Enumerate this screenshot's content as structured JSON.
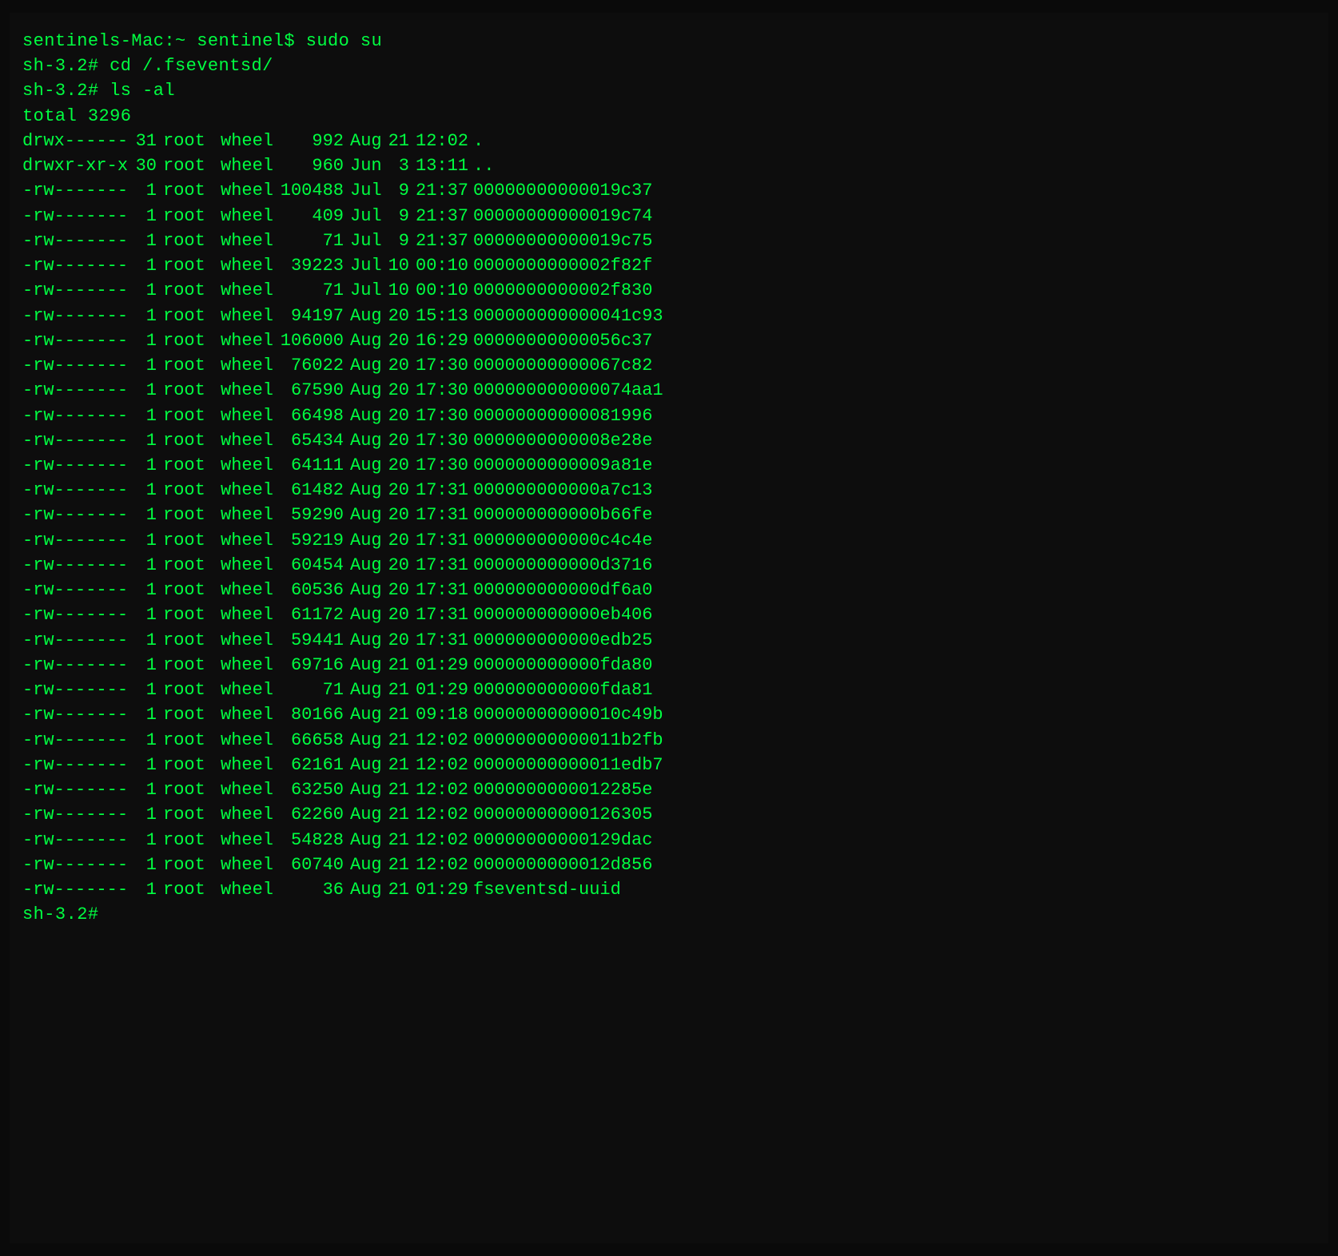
{
  "terminal": {
    "title": "sentinels-Mac:~ sentinel$",
    "prompt": "sh-3.2#",
    "lines": [
      {
        "type": "prompt-line",
        "text": "sentinels-Mac:~ sentinel$ sudo su"
      },
      {
        "type": "prompt-line",
        "text": "sh-3.2# cd /.fseventsd/"
      },
      {
        "type": "prompt-line",
        "text": "sh-3.2# ls -al"
      },
      {
        "type": "total",
        "text": "total 3296"
      },
      {
        "type": "file",
        "perms": "drwx------",
        "links": "31",
        "owner": "root",
        "group": "wheel",
        "size": "992",
        "month": "Aug",
        "day": "21",
        "time": "12:02",
        "name": "."
      },
      {
        "type": "file",
        "perms": "drwxr-xr-x",
        "links": "30",
        "owner": "root",
        "group": "wheel",
        "size": "960",
        "month": "Jun",
        "day": " 3",
        "time": "13:11",
        "name": ".."
      },
      {
        "type": "file",
        "perms": "-rw-------",
        "links": " 1",
        "owner": "root",
        "group": "wheel",
        "size": "100488",
        "month": "Jul",
        "day": " 9",
        "time": "21:37",
        "name": "00000000000019c37"
      },
      {
        "type": "file",
        "perms": "-rw-------",
        "links": " 1",
        "owner": "root",
        "group": "wheel",
        "size": "409",
        "month": "Jul",
        "day": " 9",
        "time": "21:37",
        "name": "00000000000019c74"
      },
      {
        "type": "file",
        "perms": "-rw-------",
        "links": " 1",
        "owner": "root",
        "group": "wheel",
        "size": "71",
        "month": "Jul",
        "day": " 9",
        "time": "21:37",
        "name": "00000000000019c75"
      },
      {
        "type": "file",
        "perms": "-rw-------",
        "links": " 1",
        "owner": "root",
        "group": "wheel",
        "size": "39223",
        "month": "Jul",
        "day": "10",
        "time": "00:10",
        "name": "0000000000002f82f"
      },
      {
        "type": "file",
        "perms": "-rw-------",
        "links": " 1",
        "owner": "root",
        "group": "wheel",
        "size": "71",
        "month": "Jul",
        "day": "10",
        "time": "00:10",
        "name": "0000000000002f830"
      },
      {
        "type": "file",
        "perms": "-rw-------",
        "links": " 1",
        "owner": "root",
        "group": "wheel",
        "size": "94197",
        "month": "Aug",
        "day": "20",
        "time": "15:13",
        "name": "000000000000041c93"
      },
      {
        "type": "file",
        "perms": "-rw-------",
        "links": " 1",
        "owner": "root",
        "group": "wheel",
        "size": "106000",
        "month": "Aug",
        "day": "20",
        "time": "16:29",
        "name": "00000000000056c37"
      },
      {
        "type": "file",
        "perms": "-rw-------",
        "links": " 1",
        "owner": "root",
        "group": "wheel",
        "size": "76022",
        "month": "Aug",
        "day": "20",
        "time": "17:30",
        "name": "00000000000067c82"
      },
      {
        "type": "file",
        "perms": "-rw-------",
        "links": " 1",
        "owner": "root",
        "group": "wheel",
        "size": "67590",
        "month": "Aug",
        "day": "20",
        "time": "17:30",
        "name": "000000000000074aa1"
      },
      {
        "type": "file",
        "perms": "-rw-------",
        "links": " 1",
        "owner": "root",
        "group": "wheel",
        "size": "66498",
        "month": "Aug",
        "day": "20",
        "time": "17:30",
        "name": "00000000000081996"
      },
      {
        "type": "file",
        "perms": "-rw-------",
        "links": " 1",
        "owner": "root",
        "group": "wheel",
        "size": "65434",
        "month": "Aug",
        "day": "20",
        "time": "17:30",
        "name": "0000000000008e28e"
      },
      {
        "type": "file",
        "perms": "-rw-------",
        "links": " 1",
        "owner": "root",
        "group": "wheel",
        "size": "64111",
        "month": "Aug",
        "day": "20",
        "time": "17:30",
        "name": "0000000000009a81e"
      },
      {
        "type": "file",
        "perms": "-rw-------",
        "links": " 1",
        "owner": "root",
        "group": "wheel",
        "size": "61482",
        "month": "Aug",
        "day": "20",
        "time": "17:31",
        "name": "000000000000a7c13"
      },
      {
        "type": "file",
        "perms": "-rw-------",
        "links": " 1",
        "owner": "root",
        "group": "wheel",
        "size": "59290",
        "month": "Aug",
        "day": "20",
        "time": "17:31",
        "name": "000000000000b66fe"
      },
      {
        "type": "file",
        "perms": "-rw-------",
        "links": " 1",
        "owner": "root",
        "group": "wheel",
        "size": "59219",
        "month": "Aug",
        "day": "20",
        "time": "17:31",
        "name": "000000000000c4c4e"
      },
      {
        "type": "file",
        "perms": "-rw-------",
        "links": " 1",
        "owner": "root",
        "group": "wheel",
        "size": "60454",
        "month": "Aug",
        "day": "20",
        "time": "17:31",
        "name": "000000000000d3716"
      },
      {
        "type": "file",
        "perms": "-rw-------",
        "links": " 1",
        "owner": "root",
        "group": "wheel",
        "size": "60536",
        "month": "Aug",
        "day": "20",
        "time": "17:31",
        "name": "000000000000df6a0"
      },
      {
        "type": "file",
        "perms": "-rw-------",
        "links": " 1",
        "owner": "root",
        "group": "wheel",
        "size": "61172",
        "month": "Aug",
        "day": "20",
        "time": "17:31",
        "name": "000000000000eb406"
      },
      {
        "type": "file",
        "perms": "-rw-------",
        "links": " 1",
        "owner": "root",
        "group": "wheel",
        "size": "59441",
        "month": "Aug",
        "day": "20",
        "time": "17:31",
        "name": "000000000000edb25"
      },
      {
        "type": "file",
        "perms": "-rw-------",
        "links": " 1",
        "owner": "root",
        "group": "wheel",
        "size": "69716",
        "month": "Aug",
        "day": "21",
        "time": "01:29",
        "name": "000000000000fda80"
      },
      {
        "type": "file",
        "perms": "-rw-------",
        "links": " 1",
        "owner": "root",
        "group": "wheel",
        "size": "71",
        "month": "Aug",
        "day": "21",
        "time": "01:29",
        "name": "000000000000fda81"
      },
      {
        "type": "file",
        "perms": "-rw-------",
        "links": " 1",
        "owner": "root",
        "group": "wheel",
        "size": "80166",
        "month": "Aug",
        "day": "21",
        "time": "09:18",
        "name": "00000000000010c49b"
      },
      {
        "type": "file",
        "perms": "-rw-------",
        "links": " 1",
        "owner": "root",
        "group": "wheel",
        "size": "66658",
        "month": "Aug",
        "day": "21",
        "time": "12:02",
        "name": "00000000000011b2fb"
      },
      {
        "type": "file",
        "perms": "-rw-------",
        "links": " 1",
        "owner": "root",
        "group": "wheel",
        "size": "62161",
        "month": "Aug",
        "day": "21",
        "time": "12:02",
        "name": "00000000000011edb7"
      },
      {
        "type": "file",
        "perms": "-rw-------",
        "links": " 1",
        "owner": "root",
        "group": "wheel",
        "size": "63250",
        "month": "Aug",
        "day": "21",
        "time": "12:02",
        "name": "0000000000012285e"
      },
      {
        "type": "file",
        "perms": "-rw-------",
        "links": " 1",
        "owner": "root",
        "group": "wheel",
        "size": "62260",
        "month": "Aug",
        "day": "21",
        "time": "12:02",
        "name": "00000000000126305"
      },
      {
        "type": "file",
        "perms": "-rw-------",
        "links": " 1",
        "owner": "root",
        "group": "wheel",
        "size": "54828",
        "month": "Aug",
        "day": "21",
        "time": "12:02",
        "name": "00000000000129dac"
      },
      {
        "type": "file",
        "perms": "-rw-------",
        "links": " 1",
        "owner": "root",
        "group": "wheel",
        "size": "60740",
        "month": "Aug",
        "day": "21",
        "time": "12:02",
        "name": "0000000000012d856"
      },
      {
        "type": "file",
        "perms": "-rw-------",
        "links": " 1",
        "owner": "root",
        "group": "wheel",
        "size": "36",
        "month": "Aug",
        "day": "21",
        "time": "01:29",
        "name": "fseventsd-uuid"
      },
      {
        "type": "prompt-only",
        "text": "sh-3.2# "
      }
    ]
  }
}
